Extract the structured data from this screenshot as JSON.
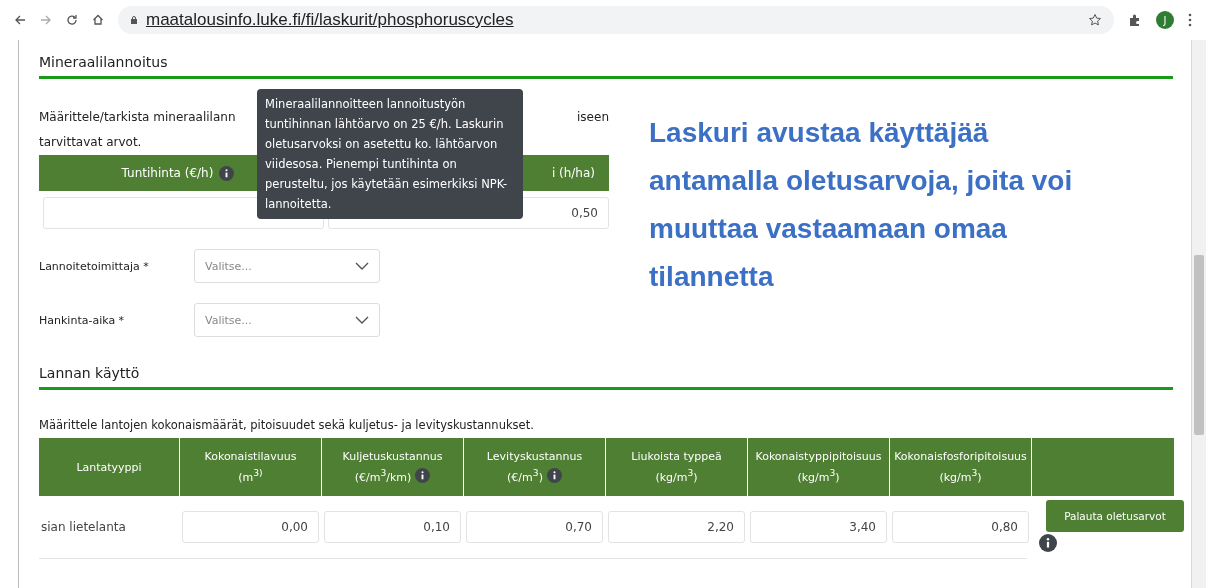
{
  "browser": {
    "url": "maatalousinfo.luke.fi/fi/laskurit/phosphoruscycles",
    "avatar": "J"
  },
  "mineral": {
    "title": "Mineraalilannoitus",
    "intro_left": "Määrittele/tarkista mineraalilann",
    "intro_right": "iseen",
    "intro_line2": "tarvittavat arvot.",
    "headers": [
      {
        "label": "Tuntihinta (€/h)",
        "info": true
      },
      {
        "label": "i (h/ha)",
        "info": false
      }
    ],
    "value_input": "0,50",
    "selects": [
      {
        "label": "Lannoitetoimittaja *",
        "placeholder": "Valitse..."
      },
      {
        "label": "Hankinta-aika *",
        "placeholder": "Valitse..."
      }
    ],
    "tooltip": "Mineraalilannoitteen lannoitustyön tuntihinnan lähtöarvo on 25 €/h. Laskurin oletusarvoksi on asetettu ko. lähtöarvon viidesosa. Pienempi tuntihinta on perusteltu, jos käytetään esimerkiksi NPK-lannoitetta."
  },
  "callout": "Laskuri avustaa käyttäjää antamalla oletusarvoja, joita voi muuttaa vastaamaan omaa tilannetta",
  "manure": {
    "title": "Lannan käyttö",
    "intro": "Määrittele lantojen kokonaismäärät, pitoisuudet sekä kuljetus- ja levityskustannukset.",
    "columns": [
      {
        "label": "Lantatyyppi",
        "info": false
      },
      {
        "label": "Kokonaistilavuus",
        "unit": "(m$^{3)}$",
        "info": false
      },
      {
        "label": "Kuljetuskustannus",
        "unit": "(€/m$^{3}$/km)",
        "info": true
      },
      {
        "label": "Levityskustannus",
        "unit": "(€/m$^{3}$)",
        "info": true
      },
      {
        "label": "Liukoista typpeä",
        "unit": "(kg/m$^{3}$)",
        "info": false
      },
      {
        "label": "Kokonaistyppipitoisuus",
        "unit": "(kg/m$^{3}$)",
        "info": false
      },
      {
        "label": "Kokonaisfosforipitoisuus",
        "unit": "(kg/m$^{3}$)",
        "info": false
      },
      {
        "info": false
      }
    ],
    "rows": [
      {
        "type": "sian lietelanta",
        "values": [
          "0,00",
          "0,10",
          "0,70",
          "2,20",
          "3,40",
          "0,80"
        ]
      }
    ],
    "reset_button": "Palauta oletusarvot"
  }
}
